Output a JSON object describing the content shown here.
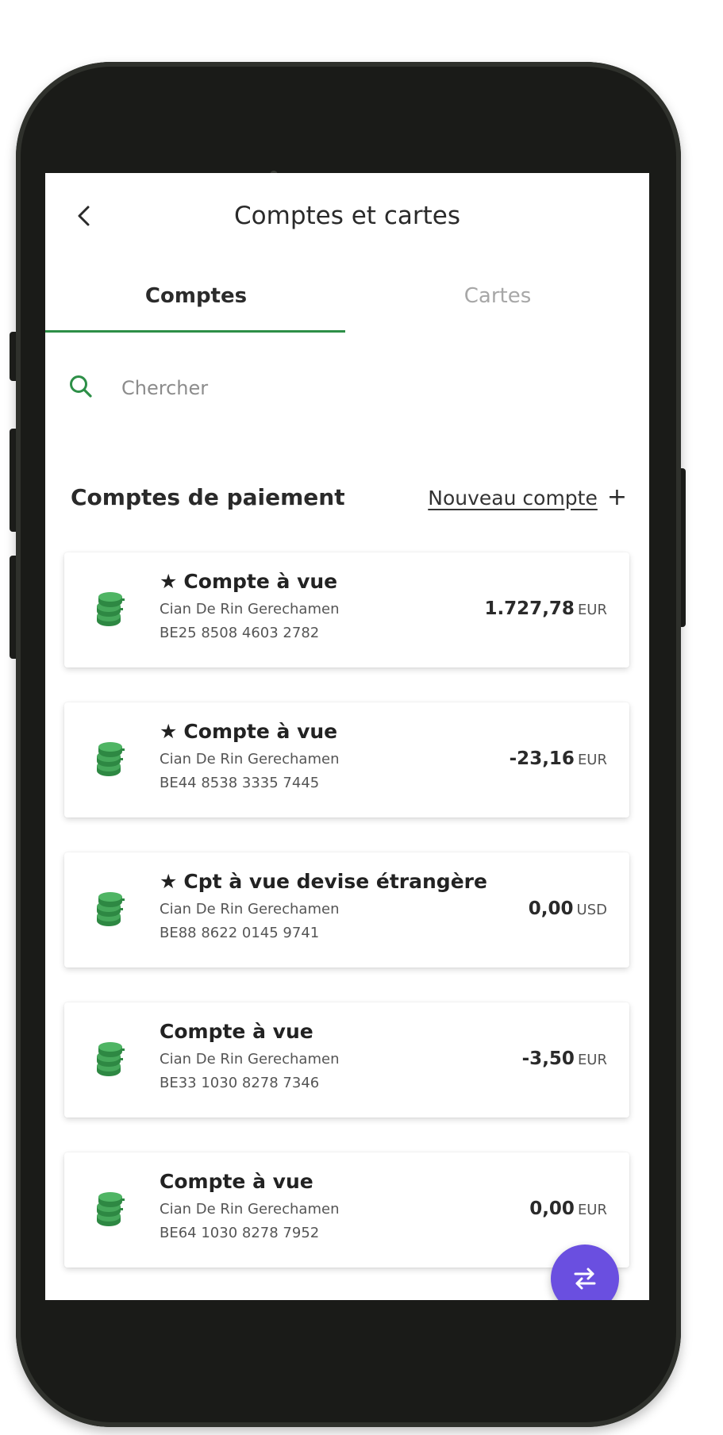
{
  "header": {
    "title": "Comptes et cartes",
    "back_icon": "chevron-left-icon"
  },
  "tabs": [
    {
      "label": "Comptes",
      "active": true
    },
    {
      "label": "Cartes",
      "active": false
    }
  ],
  "search": {
    "placeholder": "Chercher",
    "value": ""
  },
  "section": {
    "title": "Comptes de paiement",
    "new_account_label": "Nouveau compte",
    "new_account_icon": "+"
  },
  "accounts": [
    {
      "starred": true,
      "name": "Compte à vue",
      "holder": "Cian De Rin Gerechamen",
      "iban": "BE25 8508 4603 2782",
      "amount": "1.727,78",
      "currency": "EUR"
    },
    {
      "starred": true,
      "name": "Compte à vue",
      "holder": "Cian De Rin Gerechamen",
      "iban": "BE44 8538 3335 7445",
      "amount": "-23,16",
      "currency": "EUR"
    },
    {
      "starred": true,
      "name": "Cpt à vue devise étrangère",
      "holder": "Cian De Rin Gerechamen",
      "iban": "BE88 8622 0145 9741",
      "amount": "0,00",
      "currency": "USD"
    },
    {
      "starred": false,
      "name": "Compte à vue",
      "holder": "Cian De Rin Gerechamen",
      "iban": "BE33 1030 8278 7346",
      "amount": "-3,50",
      "currency": "EUR"
    },
    {
      "starred": false,
      "name": "Compte à vue",
      "holder": "Cian De Rin Gerechamen",
      "iban": "BE64 1030 8278 7952",
      "amount": "0,00",
      "currency": "EUR"
    }
  ],
  "star_symbol": "★",
  "fab": {
    "icon": "transfer-arrows-icon"
  },
  "colors": {
    "accent_green": "#2d8f47",
    "coin_green": "#3a9a4e",
    "fab_purple": "#6a4fe0",
    "phone_frame": "#1a1b18"
  }
}
